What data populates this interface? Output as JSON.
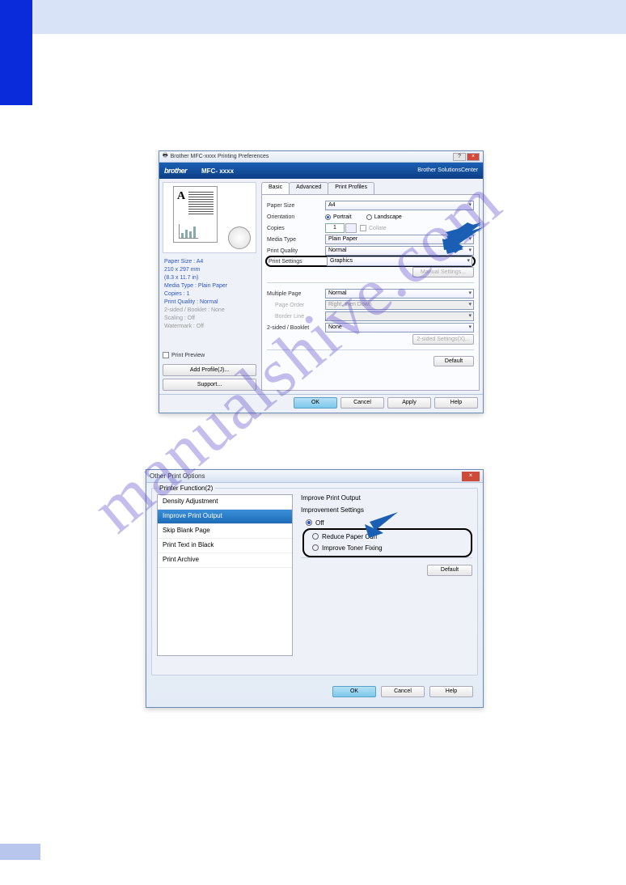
{
  "watermark": "manualshive.com",
  "dialog1": {
    "title": "Brother MFC-xxxx Printing Preferences",
    "brand": "brother",
    "model": "MFC- xxxx",
    "solutions_center": "Brother\nSolutionsCenter",
    "info": {
      "paper_size_label": "Paper Size : A4",
      "dims1": "210 x 297 mm",
      "dims2": "(8.3 x 11.7 in)",
      "media_type": "Media Type : Plain Paper",
      "copies": "Copies : 1",
      "quality": "Print Quality : Normal",
      "duplex": "2-sided / Booklet : None",
      "scaling": "Scaling : Off",
      "watermark": "Watermark : Off"
    },
    "print_preview": "Print Preview",
    "add_profile": "Add Profile(J)...",
    "support": "Support...",
    "tabs": {
      "basic": "Basic",
      "advanced": "Advanced",
      "profiles": "Print Profiles"
    },
    "fields": {
      "paper_size": "Paper Size",
      "paper_size_val": "A4",
      "orientation": "Orientation",
      "portrait": "Portrait",
      "landscape": "Landscape",
      "copies": "Copies",
      "copies_val": "1",
      "collate": "Collate",
      "media_type": "Media Type",
      "media_type_val": "Plain Paper",
      "print_quality": "Print Quality",
      "print_quality_val": "Normal",
      "print_settings": "Print Settings",
      "print_settings_val": "Graphics",
      "manual_settings": "Manual Settings...",
      "multiple_page": "Multiple Page",
      "multiple_page_val": "Normal",
      "page_order": "Page Order",
      "page_order_val": "Right, then Down",
      "border_line": "Border Line",
      "duplex": "2-sided / Booklet",
      "duplex_val": "None",
      "duplex_settings": "2-sided Settings(X)..."
    },
    "default_btn": "Default",
    "ok": "OK",
    "cancel": "Cancel",
    "apply": "Apply",
    "help": "Help"
  },
  "dialog2": {
    "title": "Other Print Options",
    "group": "Printer Function(2)",
    "list": {
      "density": "Density Adjustment",
      "improve": "Improve Print Output",
      "skip": "Skip Blank Page",
      "black": "Print Text in Black",
      "archive": "Print Archive"
    },
    "right": {
      "header": "Improve Print Output",
      "sub": "Improvement Settings",
      "off": "Off",
      "reduce": "Reduce Paper Curl",
      "toner": "Improve Toner Fixing"
    },
    "default_btn": "Default",
    "ok": "OK",
    "cancel": "Cancel",
    "help": "Help"
  }
}
